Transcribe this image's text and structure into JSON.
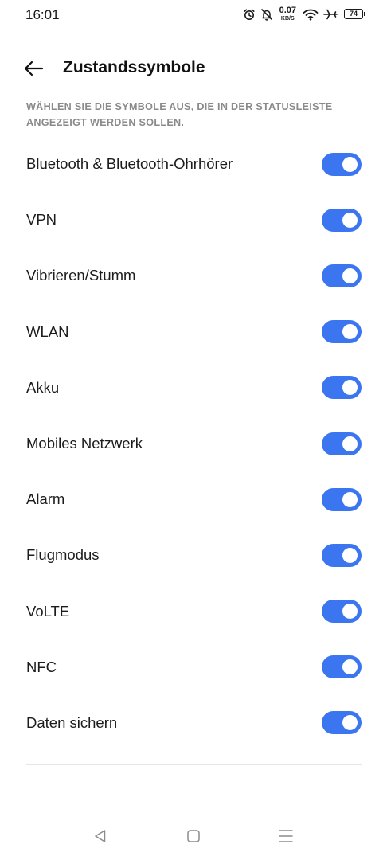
{
  "status_bar": {
    "time": "16:01",
    "net_speed_value": "0.07",
    "net_speed_unit": "KB/S",
    "battery_level": "74",
    "icons": [
      "alarm-icon",
      "bell-off-icon",
      "wifi-icon",
      "airplane-icon",
      "battery-icon"
    ]
  },
  "header": {
    "title": "Zustandssymbole",
    "back_icon": "arrow-left-icon"
  },
  "section_hint": "WÄHLEN SIE DIE SYMBOLE AUS, DIE IN DER STATUSLEISTE ANGEZEIGT WERDEN SOLLEN.",
  "items": [
    {
      "label": "Bluetooth & Bluetooth-Ohrhörer",
      "enabled": true
    },
    {
      "label": "VPN",
      "enabled": true
    },
    {
      "label": "Vibrieren/Stumm",
      "enabled": true
    },
    {
      "label": "WLAN",
      "enabled": true
    },
    {
      "label": "Akku",
      "enabled": true
    },
    {
      "label": "Mobiles Netzwerk",
      "enabled": true
    },
    {
      "label": "Alarm",
      "enabled": true
    },
    {
      "label": "Flugmodus",
      "enabled": true
    },
    {
      "label": "VoLTE",
      "enabled": true
    },
    {
      "label": "NFC",
      "enabled": true
    },
    {
      "label": "Daten sichern",
      "enabled": true
    }
  ],
  "nav_bar": {
    "icons": [
      "back-triangle-icon",
      "home-square-icon",
      "menu-lines-icon"
    ]
  },
  "colors": {
    "accent": "#3b76f0",
    "hint_text": "#8a8a8a",
    "background": "#ffffff"
  }
}
